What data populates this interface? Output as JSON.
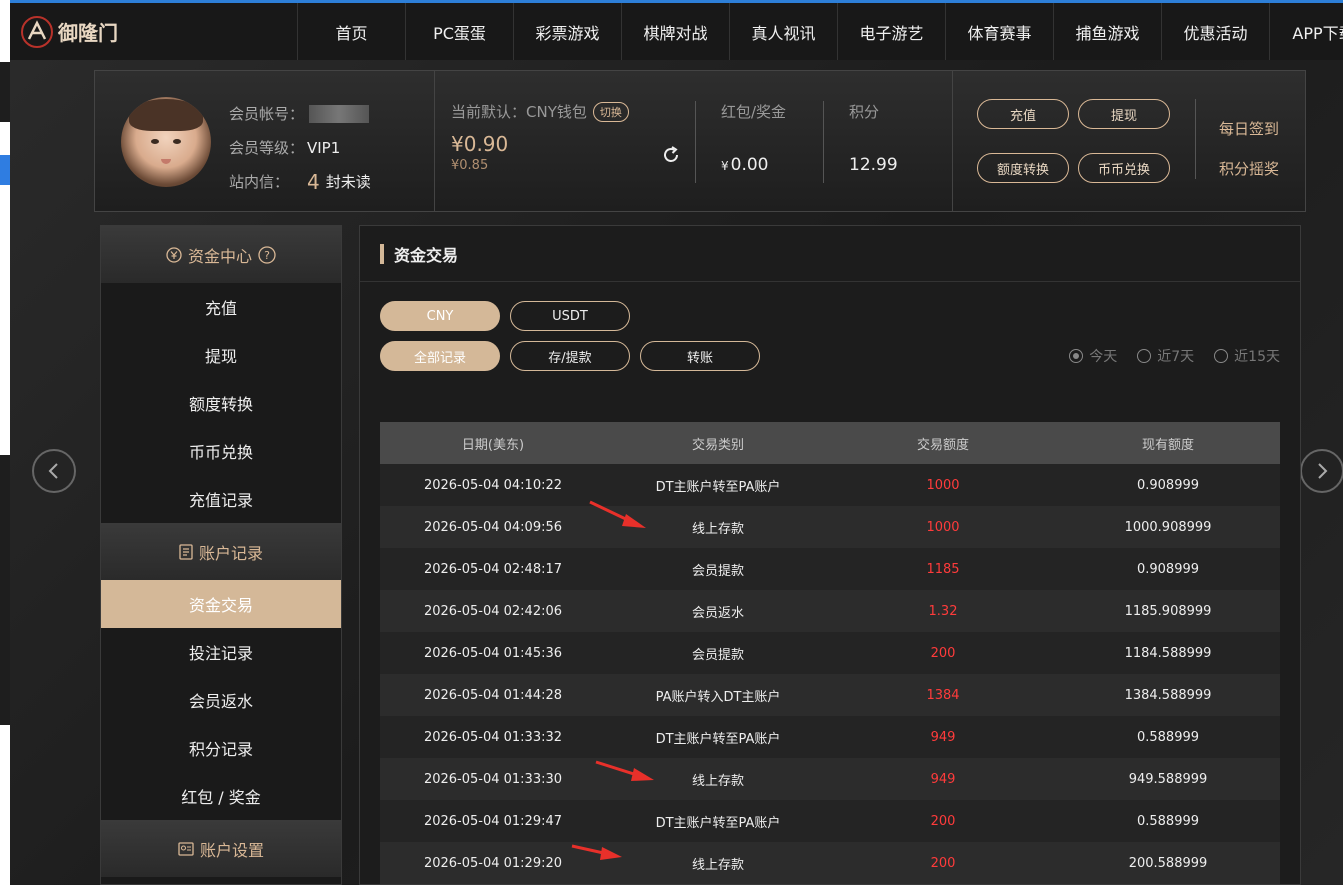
{
  "brand": {
    "name": "御隆门",
    "subtitle": ""
  },
  "nav": [
    "首页",
    "PC蛋蛋",
    "彩票游戏",
    "棋牌对战",
    "真人视讯",
    "电子游艺",
    "体育赛事",
    "捕鱼游戏",
    "优惠活动",
    "APP下载"
  ],
  "user": {
    "account_label": "会员帐号：",
    "level_label": "会员等级：",
    "level_value": "VIP1",
    "inbox_label": "站内信：",
    "inbox_count": "4",
    "inbox_unit": "封未读"
  },
  "wallet": {
    "default_label": "当前默认：CNY钱包",
    "switch_label": "切换",
    "balance": "¥0.90",
    "balance_sub": "¥0.85"
  },
  "bonus": {
    "label": "红包/奖金",
    "currency": "¥",
    "value": "0.00"
  },
  "points": {
    "label": "积分",
    "value": "12.99"
  },
  "actions": {
    "deposit": "充值",
    "withdraw": "提现",
    "transfer": "额度转换",
    "exchange": "币币兑换"
  },
  "side_links": {
    "checkin": "每日签到",
    "lottery": "积分摇奖"
  },
  "sidebar": {
    "funds_header": "资金中心",
    "funds_items": [
      "充值",
      "提现",
      "额度转换",
      "币币兑换",
      "充值记录"
    ],
    "records_header": "账户记录",
    "records_items": [
      "资金交易",
      "投注记录",
      "会员返水",
      "积分记录",
      "红包 / 奖金"
    ],
    "settings_header": "账户设置"
  },
  "main": {
    "title": "资金交易",
    "currency_tabs": [
      "CNY",
      "USDT"
    ],
    "type_tabs": [
      "全部记录",
      "存/提款",
      "转账"
    ],
    "range_options": [
      "今天",
      "近7天",
      "近15天"
    ],
    "columns": [
      "日期(美东)",
      "交易类别",
      "交易额度",
      "现有额度"
    ],
    "rows": [
      [
        "2026-05-04 04:10:22",
        "DT主账户转至PA账户",
        "1000",
        "0.908999"
      ],
      [
        "2026-05-04 04:09:56",
        "线上存款",
        "1000",
        "1000.908999"
      ],
      [
        "2026-05-04 02:48:17",
        "会员提款",
        "1185",
        "0.908999"
      ],
      [
        "2026-05-04 02:42:06",
        "会员返水",
        "1.32",
        "1185.908999"
      ],
      [
        "2026-05-04 01:45:36",
        "会员提款",
        "200",
        "1184.588999"
      ],
      [
        "2026-05-04 01:44:28",
        "PA账户转入DT主账户",
        "1384",
        "1384.588999"
      ],
      [
        "2026-05-04 01:33:32",
        "DT主账户转至PA账户",
        "949",
        "0.588999"
      ],
      [
        "2026-05-04 01:33:30",
        "线上存款",
        "949",
        "949.588999"
      ],
      [
        "2026-05-04 01:29:47",
        "DT主账户转至PA账户",
        "200",
        "0.588999"
      ],
      [
        "2026-05-04 01:29:20",
        "线上存款",
        "200",
        "200.588999"
      ]
    ]
  },
  "colors": {
    "accent": "#d4b898",
    "amount": "#ff3b3b",
    "annotation_arrow": "#e8302a"
  }
}
